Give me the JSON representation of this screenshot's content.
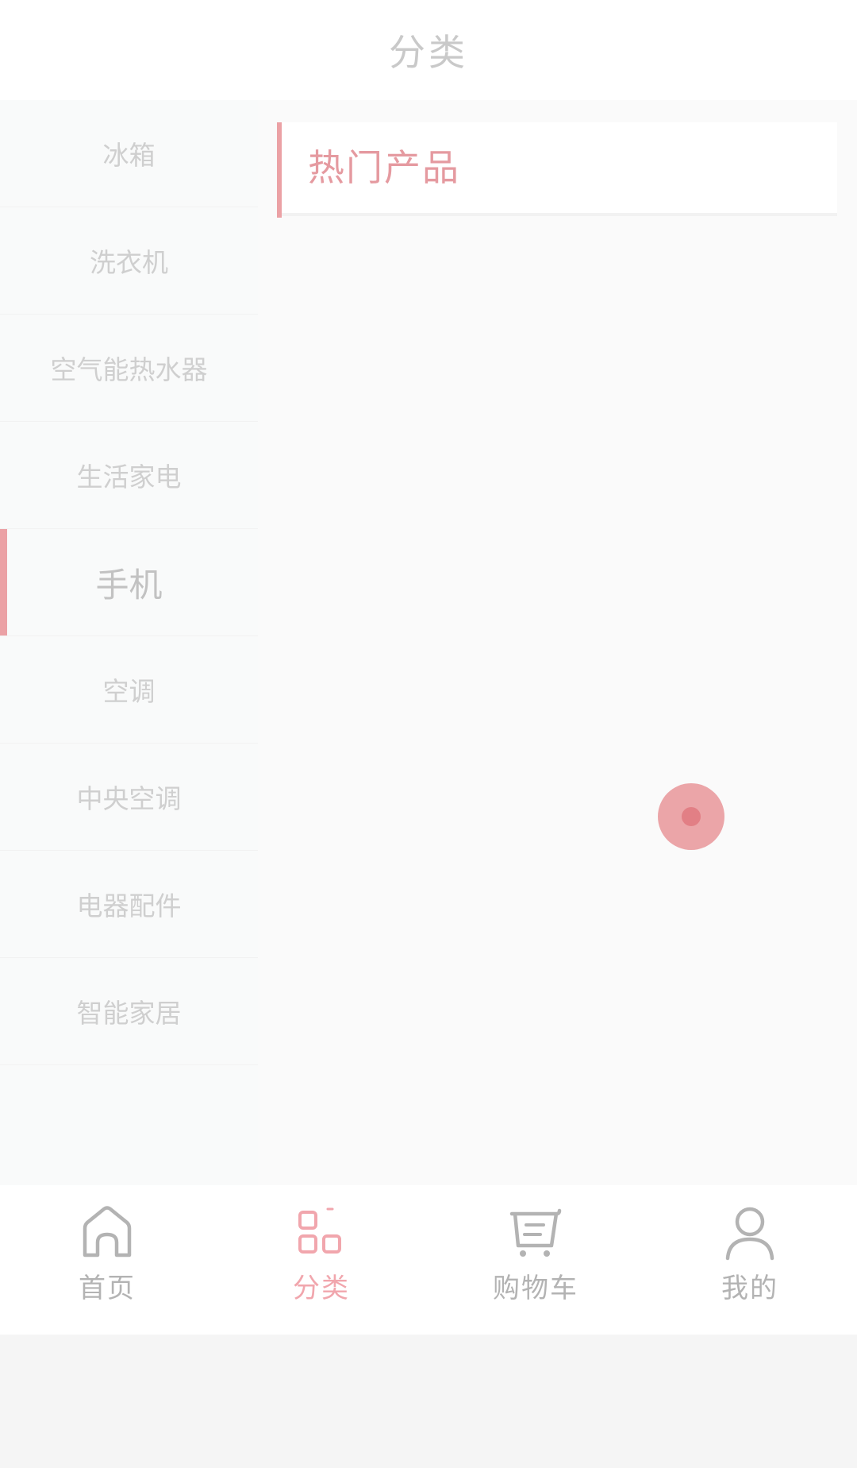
{
  "header": {
    "title": "分类"
  },
  "sidebar": {
    "items": [
      {
        "label": "冰箱"
      },
      {
        "label": "洗衣机"
      },
      {
        "label": "空气能热水器"
      },
      {
        "label": "生活家电"
      },
      {
        "label": "手机"
      },
      {
        "label": "空调"
      },
      {
        "label": "中央空调"
      },
      {
        "label": "电器配件"
      },
      {
        "label": "智能家居"
      }
    ],
    "active_index": 4
  },
  "content": {
    "section_title": "热门产品"
  },
  "tabbar": {
    "items": [
      {
        "label": "首页",
        "icon": "home-icon"
      },
      {
        "label": "分类",
        "icon": "category-icon"
      },
      {
        "label": "购物车",
        "icon": "cart-icon"
      },
      {
        "label": "我的",
        "icon": "user-icon"
      }
    ],
    "active_index": 1
  },
  "colors": {
    "accent": "#eba1a5",
    "inactive_text": "#cfcfcf",
    "tab_active": "#f1a6ad"
  }
}
